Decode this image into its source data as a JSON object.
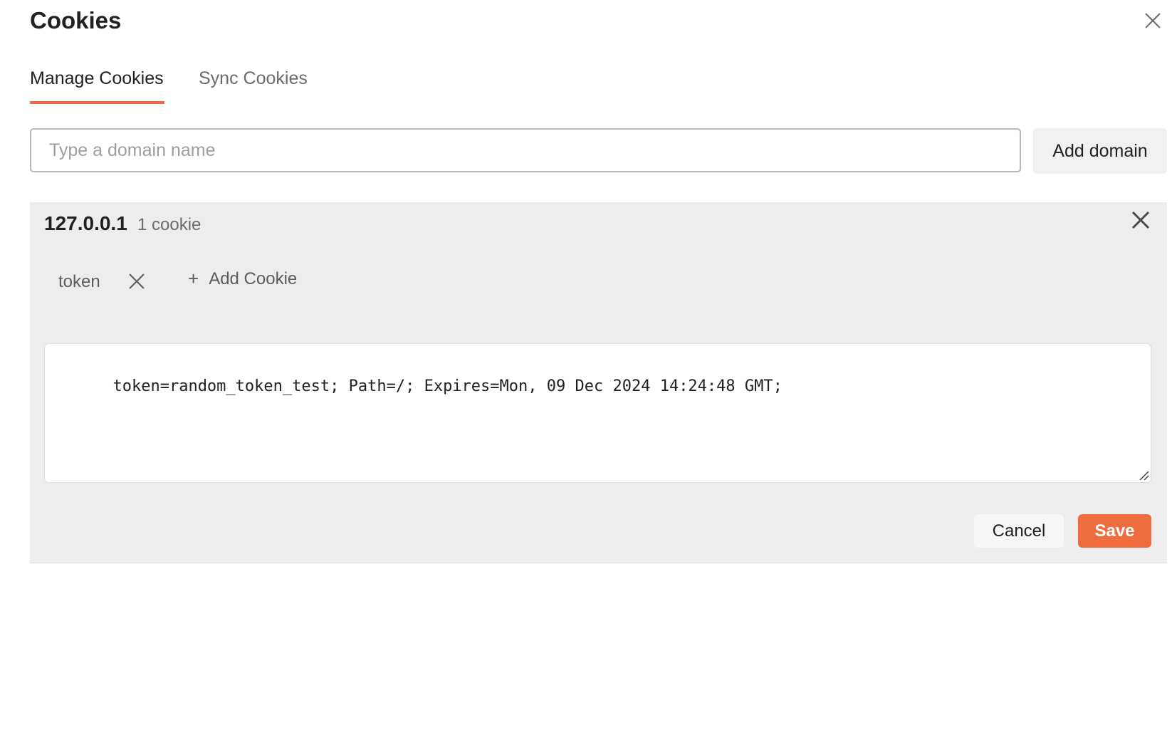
{
  "dialog": {
    "title": "Cookies",
    "close_icon": "close-icon"
  },
  "tabs": [
    {
      "label": "Manage Cookies",
      "active": true
    },
    {
      "label": "Sync Cookies",
      "active": false
    }
  ],
  "domain_input": {
    "value": "",
    "placeholder": "Type a domain name"
  },
  "add_domain_label": "Add domain",
  "domain": {
    "name": "127.0.0.1",
    "count_label": "1 cookie",
    "remove_icon": "close-icon",
    "cookies": [
      {
        "name": "token",
        "remove_icon": "close-icon"
      }
    ],
    "add_cookie_label": "Add Cookie",
    "add_cookie_icon": "plus-icon",
    "editor_value": "token=random_token_test; Path=/; Expires=Mon, 09 Dec 2024 14:24:48 GMT;",
    "cancel_label": "Cancel",
    "save_label": "Save"
  },
  "colors": {
    "accent": "#ef6c3e",
    "panel_bg": "#ededed",
    "button_bg": "#f1f1f1"
  }
}
